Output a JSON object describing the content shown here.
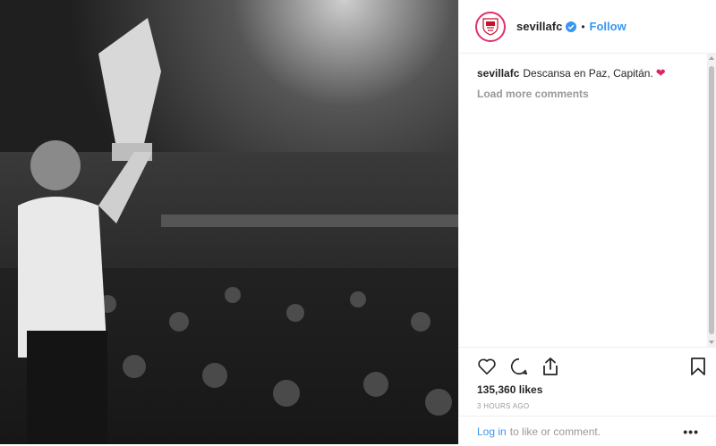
{
  "post": {
    "image_alt_icon": "photo",
    "header": {
      "username": "sevillafc",
      "verified_icon": "verified-badge-icon",
      "separator": "•",
      "follow_label": "Follow"
    },
    "caption": {
      "username": "sevillafc",
      "text": "Descansa en Paz, Capitán.",
      "emoji": "❤"
    },
    "load_more_label": "Load more comments",
    "likes": "135,360 likes",
    "timestamp": "3 HOURS AGO",
    "login": {
      "link_label": "Log in",
      "rest_text": "to like or comment.",
      "more_icon": "more-options-icon"
    },
    "colors": {
      "accent": "#3897f0",
      "heart": "#e0245e",
      "muted": "#999999"
    }
  }
}
